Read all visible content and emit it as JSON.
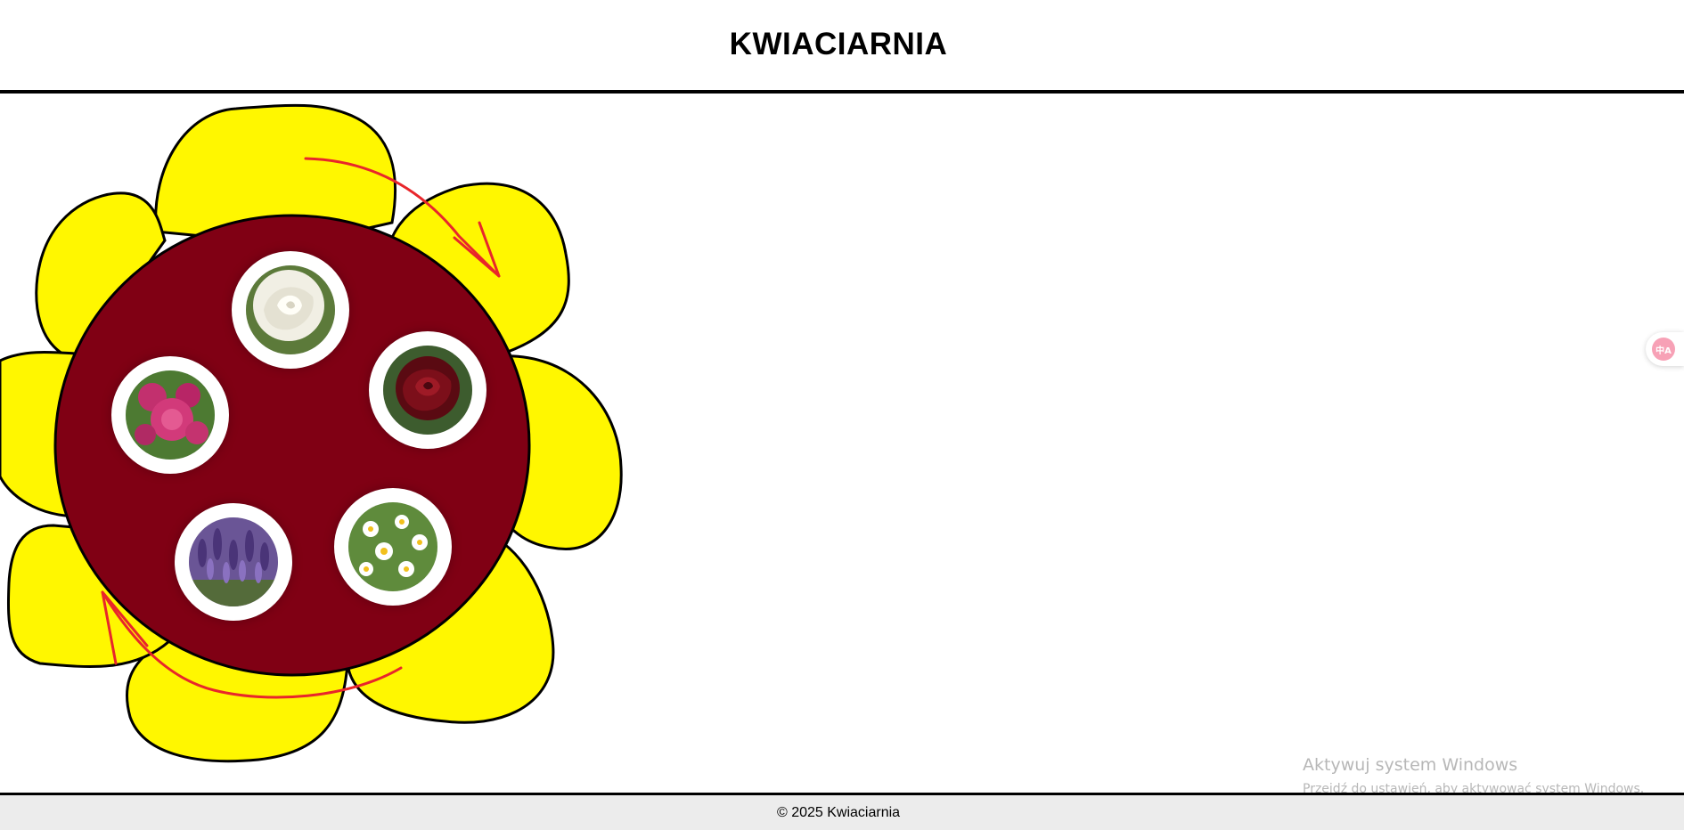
{
  "header": {
    "title": "KWIACIARNIA"
  },
  "flower": {
    "petal_color": "#fff700",
    "center_color": "#800014",
    "arrow_color": "#e8262b",
    "thumbnails": [
      {
        "name": "white-rose"
      },
      {
        "name": "red-rose"
      },
      {
        "name": "peony"
      },
      {
        "name": "lavender"
      },
      {
        "name": "daisy"
      }
    ]
  },
  "translate_widget": {
    "icon": "translate-icon",
    "label": "中A"
  },
  "windows_watermark": {
    "title": "Aktywuj system Windows",
    "subtitle": "Przejdź do ustawień, aby aktywować system Windows."
  },
  "footer": {
    "text": "© 2025 Kwiaciarnia"
  }
}
